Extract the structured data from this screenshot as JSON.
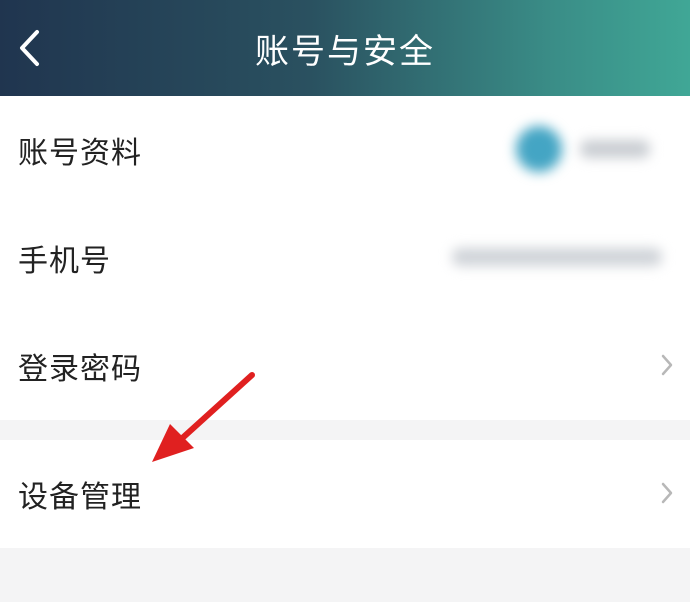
{
  "header": {
    "title": "账号与安全"
  },
  "rows": [
    {
      "label": "账号资料"
    },
    {
      "label": "手机号"
    },
    {
      "label": "登录密码"
    },
    {
      "label": "设备管理"
    }
  ],
  "colors": {
    "annotation_arrow": "#e02020"
  }
}
